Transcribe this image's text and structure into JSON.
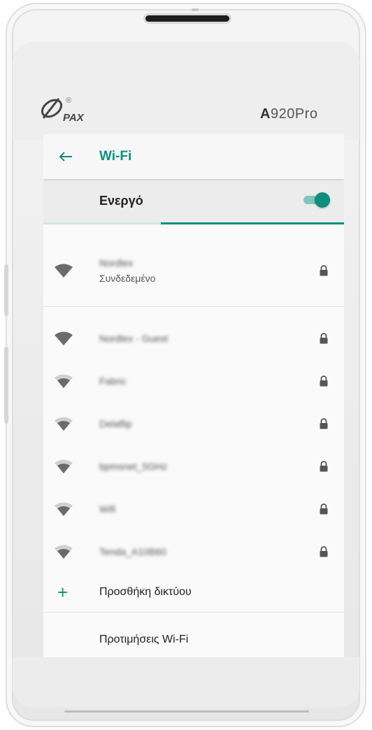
{
  "device": {
    "brand": "PAX",
    "registered_mark": "®",
    "model_prefix": "A",
    "model_suffix": "920Pro"
  },
  "appbar": {
    "title": "Wi-Fi",
    "back_icon": "arrow-left-icon"
  },
  "wifi_master": {
    "label": "Ενεργό",
    "enabled": true,
    "scan_progress": 0.61
  },
  "colors": {
    "accent": "#0e8f80",
    "accent_light": "#7fc6bd",
    "text_primary": "#222222",
    "text_secondary": "#555555"
  },
  "connected_network": {
    "ssid": "Nordlex",
    "status": "Συνδεδεμένο",
    "signal": 4,
    "secured": true
  },
  "networks": [
    {
      "ssid": "Nordlex - Guest",
      "signal": 4,
      "secured": true
    },
    {
      "ssid": "Fabric",
      "signal": 3,
      "secured": true
    },
    {
      "ssid": "Delaflip",
      "signal": 3,
      "secured": true
    },
    {
      "ssid": "bpmsnet_5GHz",
      "signal": 3,
      "secured": true
    },
    {
      "ssid": "Wifi",
      "signal": 3,
      "secured": true
    },
    {
      "ssid": "Tenda_A10B60",
      "signal": 3,
      "secured": true
    }
  ],
  "actions": {
    "add_network": "Προσθήκη δικτύου",
    "add_icon": "plus-icon",
    "preferences": "Προτιμήσεις Wi-Fi"
  }
}
